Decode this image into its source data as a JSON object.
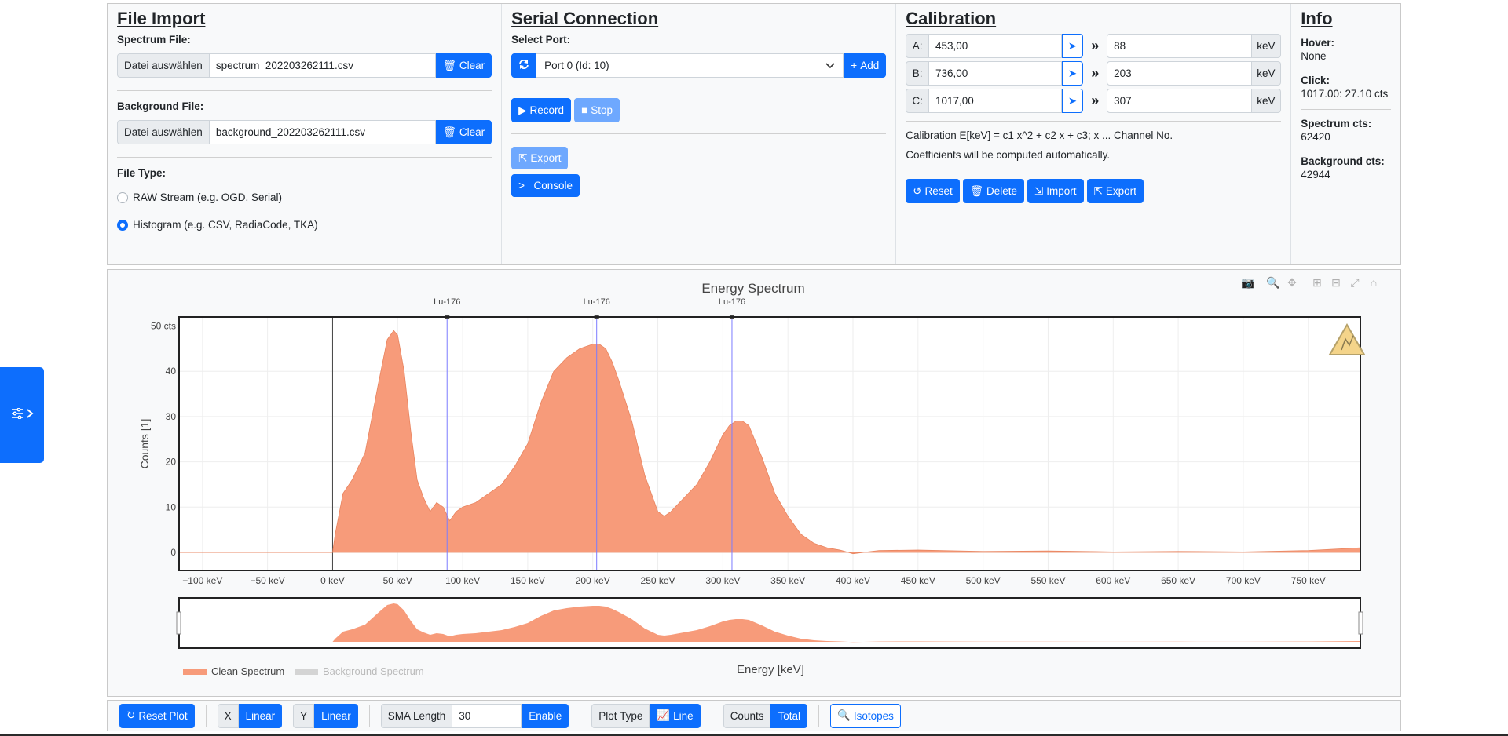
{
  "file_import": {
    "title": "File Import",
    "spectrum_label": "Spectrum File:",
    "spectrum_browse": "Datei auswählen",
    "spectrum_name": "spectrum_202203262111.csv",
    "clear": "Clear",
    "background_label": "Background File:",
    "background_browse": "Datei auswählen",
    "background_name": "background_202203262111.csv",
    "filetype_label": "File Type:",
    "raw_option": "RAW Stream (e.g. OGD, Serial)",
    "hist_option": "Histogram (e.g. CSV, RadiaCode, TKA)"
  },
  "serial": {
    "title": "Serial Connection",
    "port_label": "Select Port:",
    "port_value": "Port 0 (Id: 10)",
    "add": "Add",
    "record": "Record",
    "stop": "Stop",
    "export": "Export",
    "console": "Console"
  },
  "calibration": {
    "title": "Calibration",
    "rows": [
      {
        "label": "A:",
        "channel": "453,00",
        "energy": "88",
        "unit": "keV"
      },
      {
        "label": "B:",
        "channel": "736,00",
        "energy": "203",
        "unit": "keV"
      },
      {
        "label": "C:",
        "channel": "1017,00",
        "energy": "307",
        "unit": "keV"
      }
    ],
    "formula": "Calibration E[keV] = c1 x^2 + c2 x + c3; x ... Channel No.",
    "note": "Coefficients will be computed automatically.",
    "reset": "Reset",
    "delete": "Delete",
    "import": "Import",
    "export": "Export"
  },
  "info": {
    "title": "Info",
    "hover_k": "Hover:",
    "hover_v": "None",
    "click_k": "Click:",
    "click_v": "1017.00: 27.10 cts",
    "spec_k": "Spectrum cts:",
    "spec_v": "62420",
    "bg_k": "Background cts:",
    "bg_v": "42944"
  },
  "bottom": {
    "reset_plot": "Reset Plot",
    "x_label": "X",
    "x_value": "Linear",
    "y_label": "Y",
    "y_value": "Linear",
    "sma_label": "SMA Length",
    "sma_value": "30",
    "enable": "Enable",
    "plot_type_label": "Plot Type",
    "plot_type_value": "Line",
    "counts_label": "Counts",
    "counts_value": "Total",
    "isotopes": "Isotopes"
  },
  "chart_data": {
    "type": "area",
    "title": "Energy Spectrum",
    "xlabel": "Energy [keV]",
    "ylabel": "Counts [1]",
    "xlim": [
      -118,
      790
    ],
    "ylim": [
      -4,
      52
    ],
    "x_ticks": [
      -100,
      -50,
      0,
      50,
      100,
      150,
      200,
      250,
      300,
      350,
      400,
      450,
      500,
      550,
      600,
      650,
      700,
      750
    ],
    "x_tick_labels": [
      "−100 keV",
      "−50 keV",
      "0 keV",
      "50 keV",
      "100 keV",
      "150 keV",
      "200 keV",
      "250 keV",
      "300 keV",
      "350 keV",
      "400 keV",
      "450 keV",
      "500 keV",
      "550 keV",
      "600 keV",
      "650 keV",
      "700 keV",
      "750 keV"
    ],
    "y_ticks": [
      0,
      10,
      20,
      30,
      40,
      50
    ],
    "y_tick_labels": [
      "0",
      "10",
      "20",
      "30",
      "40",
      "50 cts"
    ],
    "grid": true,
    "legend_position": "bottom-left",
    "series": [
      {
        "name": "Clean Spectrum",
        "color": "#f79b7a",
        "x": [
          -118,
          -10,
          0,
          2,
          8,
          15,
          25,
          35,
          42,
          47,
          50,
          55,
          60,
          65,
          70,
          75,
          80,
          85,
          90,
          95,
          100,
          110,
          120,
          130,
          140,
          150,
          160,
          170,
          180,
          190,
          200,
          205,
          210,
          215,
          220,
          230,
          240,
          250,
          255,
          260,
          270,
          280,
          290,
          300,
          305,
          310,
          315,
          320,
          330,
          340,
          350,
          360,
          370,
          380,
          390,
          400,
          420,
          450,
          500,
          550,
          600,
          650,
          700,
          750,
          790
        ],
        "y": [
          0,
          0,
          0,
          4,
          13,
          16,
          22,
          37,
          47,
          49,
          48,
          40,
          27,
          16,
          12,
          9,
          11,
          10,
          7,
          9,
          10,
          11,
          13,
          15,
          19,
          24,
          33,
          40,
          43,
          45,
          46,
          46,
          45,
          42,
          38,
          29,
          17,
          9,
          8,
          9,
          12,
          15,
          20,
          26,
          28,
          29,
          29,
          28,
          21,
          13,
          8,
          4,
          2,
          1,
          0.5,
          -0.3,
          0.4,
          0.5,
          0.2,
          0.3,
          0.1,
          0.2,
          0.1,
          0.4,
          1
        ]
      },
      {
        "name": "Background Spectrum",
        "color": "#d4d4d4",
        "x": [],
        "y": []
      }
    ],
    "annotations": [
      {
        "x": 88,
        "label": "Lu-176"
      },
      {
        "x": 203,
        "label": "Lu-176"
      },
      {
        "x": 307,
        "label": "Lu-176"
      }
    ]
  }
}
